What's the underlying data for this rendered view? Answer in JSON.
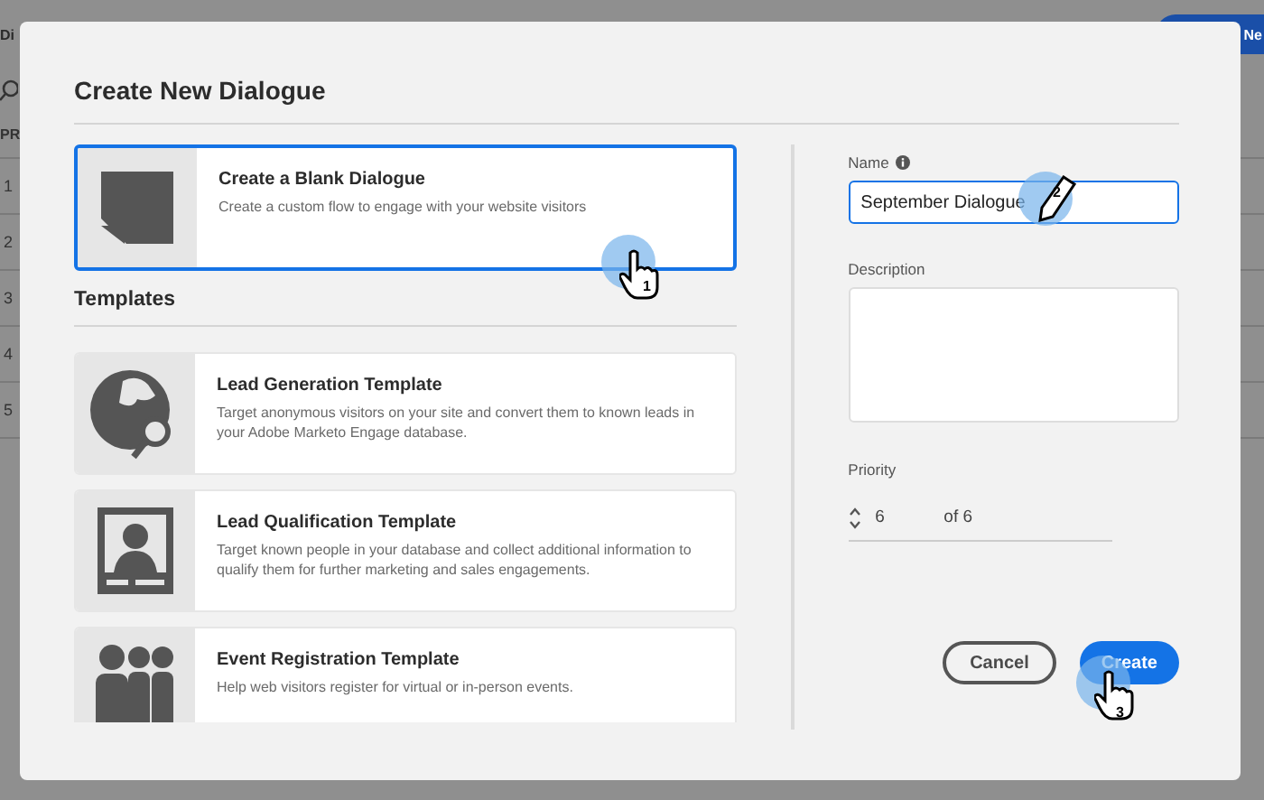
{
  "background": {
    "title": "Di",
    "button": "Ne",
    "column_header": "PR",
    "rows": [
      "1",
      "2",
      "3",
      "4",
      "5"
    ]
  },
  "dialog": {
    "title": "Create New Dialogue",
    "blank": {
      "title": "Create a Blank Dialogue",
      "description": "Create a custom flow to engage with your website visitors",
      "selected": true
    },
    "templates_heading": "Templates",
    "templates": [
      {
        "kind": "globe",
        "title": "Lead Generation Template",
        "description": "Target anonymous visitors on your site and convert them to known leads in your Adobe Marketo Engage database."
      },
      {
        "kind": "portrait",
        "title": "Lead Qualification Template",
        "description": "Target known people in your database and collect additional information to qualify them for further marketing and sales engagements."
      },
      {
        "kind": "group",
        "title": "Event Registration Template",
        "description": "Help web visitors register for virtual or in-person events."
      }
    ],
    "form": {
      "name_label": "Name",
      "name_value": "September Dialogue",
      "description_label": "Description",
      "priority_label": "Priority",
      "priority_value": "6",
      "priority_total": "of 6"
    },
    "buttons": [
      {
        "label": "Cancel",
        "kind": "secondary"
      },
      {
        "label": "Create",
        "kind": "primary"
      }
    ]
  },
  "steps": [
    {
      "number": "1",
      "kind": "hand"
    },
    {
      "number": "2",
      "kind": "pencil"
    },
    {
      "number": "3",
      "kind": "hand"
    }
  ]
}
